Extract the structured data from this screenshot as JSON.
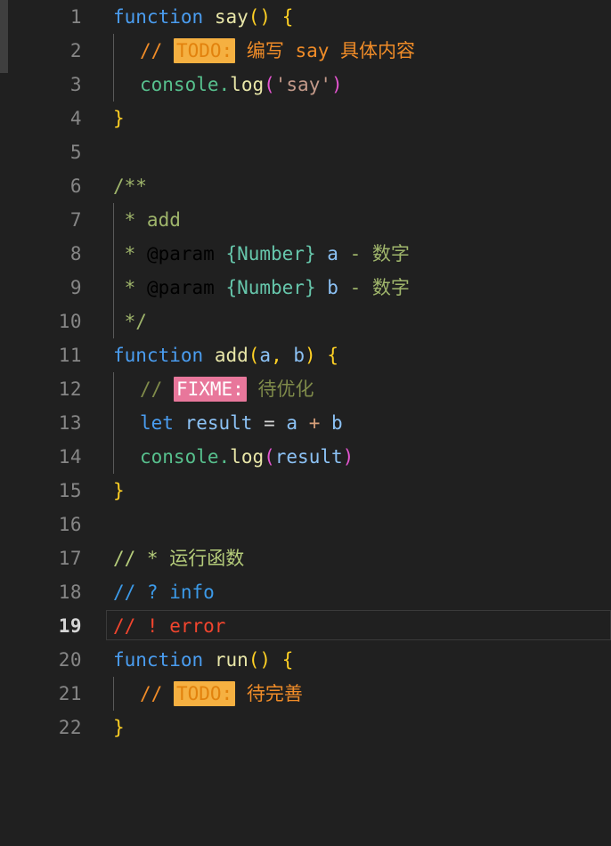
{
  "editor": {
    "background_color": "#202020",
    "active_line": 19,
    "gutter": {
      "line_number_color": "#868686",
      "active_line_number_color": "#d6d6d6"
    },
    "scrollbar": {
      "name": "vertical-scrollbar",
      "thumb_color": "#3f3f3f",
      "thumb_top": 0,
      "thumb_height": 82
    },
    "lines": [
      {
        "number": "1",
        "text": "function say() {"
      },
      {
        "number": "2",
        "text": "  // TODO: 编写 say 具体内容"
      },
      {
        "number": "3",
        "text": "  console.log('say')"
      },
      {
        "number": "4",
        "text": "}"
      },
      {
        "number": "5",
        "text": ""
      },
      {
        "number": "6",
        "text": "/**"
      },
      {
        "number": "7",
        "text": " * add"
      },
      {
        "number": "8",
        "text": " * @param {Number} a - 数字"
      },
      {
        "number": "9",
        "text": " * @param {Number} b - 数字"
      },
      {
        "number": "10",
        "text": " */"
      },
      {
        "number": "11",
        "text": "function add(a, b) {"
      },
      {
        "number": "12",
        "text": "  // FIXME: 待优化"
      },
      {
        "number": "13",
        "text": "  let result = a + b"
      },
      {
        "number": "14",
        "text": "  console.log(result)"
      },
      {
        "number": "15",
        "text": "}"
      },
      {
        "number": "16",
        "text": ""
      },
      {
        "number": "17",
        "text": "// * 运行函数"
      },
      {
        "number": "18",
        "text": "// ? info"
      },
      {
        "number": "19",
        "text": "// ! error"
      },
      {
        "number": "20",
        "text": "function run() {"
      },
      {
        "number": "21",
        "text": "  // TODO: 待完善"
      },
      {
        "number": "22",
        "text": "}"
      }
    ],
    "tokens": {
      "kw_function": "function",
      "kw_let": "let",
      "fn_say": "say",
      "fn_add": "add",
      "fn_run": "run",
      "fn_log": "log",
      "obj_console": "console",
      "str_say": "'say'",
      "var_result": "result",
      "var_a": "a",
      "var_b": "b",
      "badge_todo": "TODO:",
      "badge_fixme": "FIXME:",
      "todo_say_text": "编写 say 具体内容",
      "todo_run_text": "待完善",
      "fixme_text": "待优化",
      "jsdoc_open": "/**",
      "jsdoc_close": " */",
      "jsdoc_add": " * add",
      "jsdoc_tag": "@param",
      "jsdoc_type": "{Number}",
      "jsdoc_desc": "数字",
      "jsdoc_dash": "-",
      "comment_star_text": "// * 运行函数",
      "comment_question_text": "// ? info",
      "comment_bang_text": "// ! error",
      "slashes": "//"
    },
    "colors": {
      "keyword": "#4a9df0",
      "function_name": "#e8e6a8",
      "paren_yellow": "#ffd024",
      "paren_magenta": "#e455d0",
      "parameter": "#8cc2f5",
      "console_green": "#57c08d",
      "string": "#c49a8a",
      "todo_badge_bg": "#f5b041",
      "todo_badge_fg": "#e2820d",
      "todo_comment": "#f08c28",
      "fixme_badge_bg": "#e8779b",
      "fixme_badge_fg": "#ffffff",
      "fixme_comment": "#7f8b4a",
      "comment_star": "#b5cc7a",
      "comment_question": "#3c9ae8",
      "comment_bang": "#f2452e",
      "jsdoc_comment": "#9fb56b",
      "jsdoc_tag": "#4a9df0",
      "jsdoc_type": "#66c6ab"
    }
  }
}
